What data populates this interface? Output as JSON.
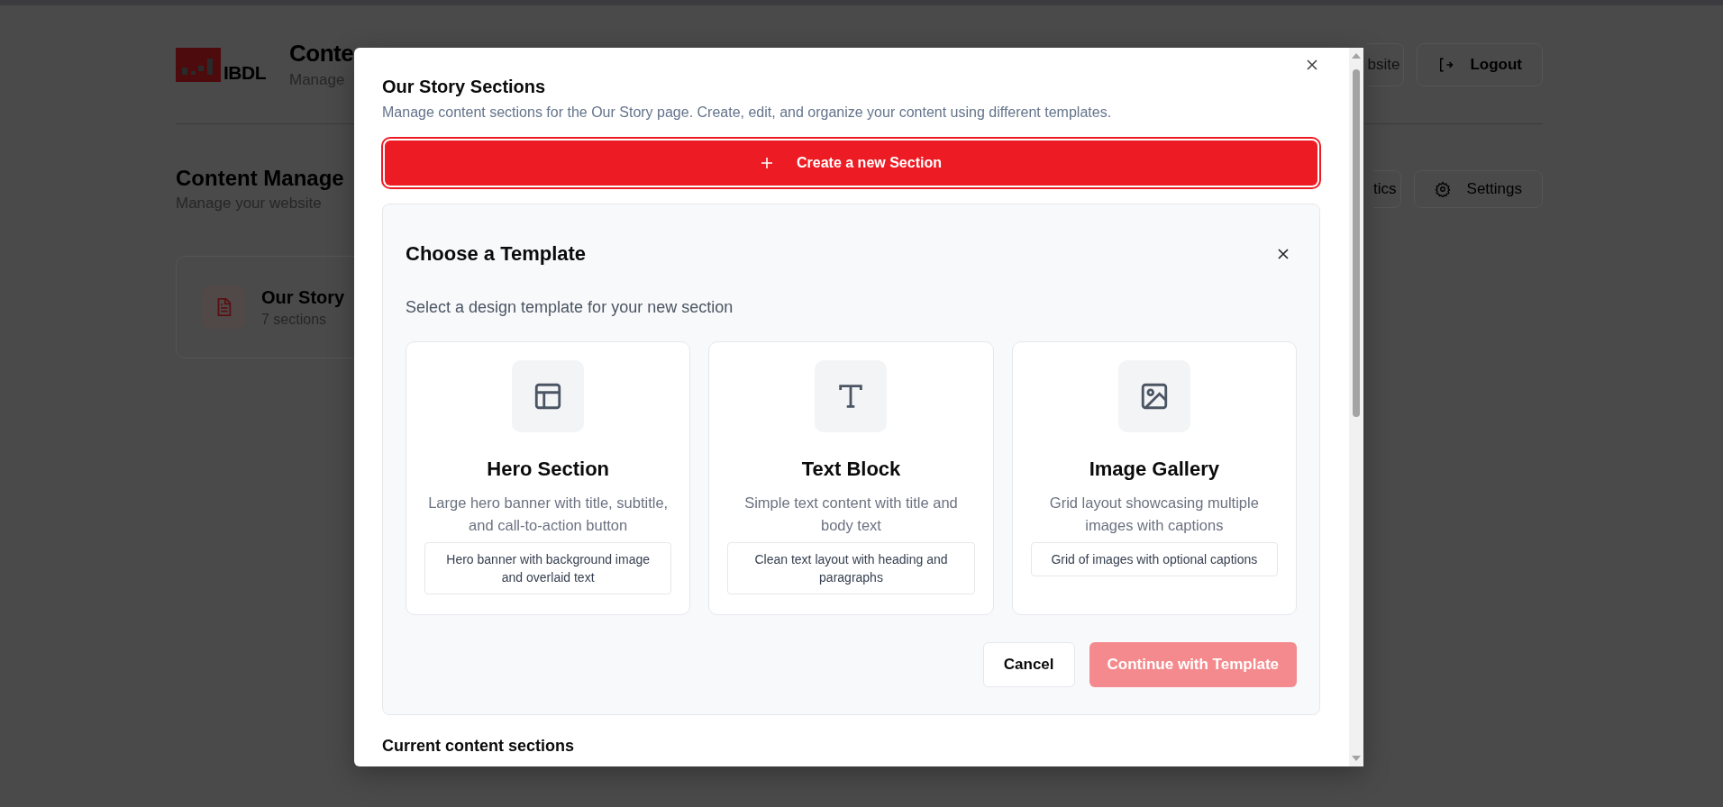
{
  "background": {
    "header": {
      "brand": "IBDL",
      "title": "Conte",
      "subtitle": "Manage",
      "buttons": [
        {
          "label": "bsite"
        },
        {
          "label": "Logout"
        }
      ]
    },
    "section": {
      "title": "Content Manage",
      "subtitle": "Manage your website",
      "buttons": [
        {
          "label": "tics"
        },
        {
          "label": "Settings"
        }
      ]
    },
    "cards": [
      {
        "title": "Our Story",
        "count": "7 sections"
      }
    ]
  },
  "dialog": {
    "title": "Our Story Sections",
    "description": "Manage content sections for the Our Story page. Create, edit, and organize your content using different templates.",
    "create_button": "Create a new Section",
    "template_picker": {
      "title": "Choose a Template",
      "subtitle": "Select a design template for your new section",
      "templates": [
        {
          "name": "Hero Section",
          "description": "Large hero banner with title, subtitle, and call-to-action button",
          "example": "Hero banner with background image and overlaid text",
          "selected": false
        },
        {
          "name": "Text Block",
          "description": "Simple text content with title and body text",
          "example": "Clean text layout with heading and paragraphs",
          "selected": false
        },
        {
          "name": "Image Gallery",
          "description": "Grid layout showcasing multiple images with captions",
          "example": "Grid of images with optional captions",
          "selected": false
        }
      ],
      "cancel": "Cancel",
      "continue": {
        "label": "Continue with Template",
        "disabled": true
      }
    },
    "current_heading": "Current content sections"
  }
}
